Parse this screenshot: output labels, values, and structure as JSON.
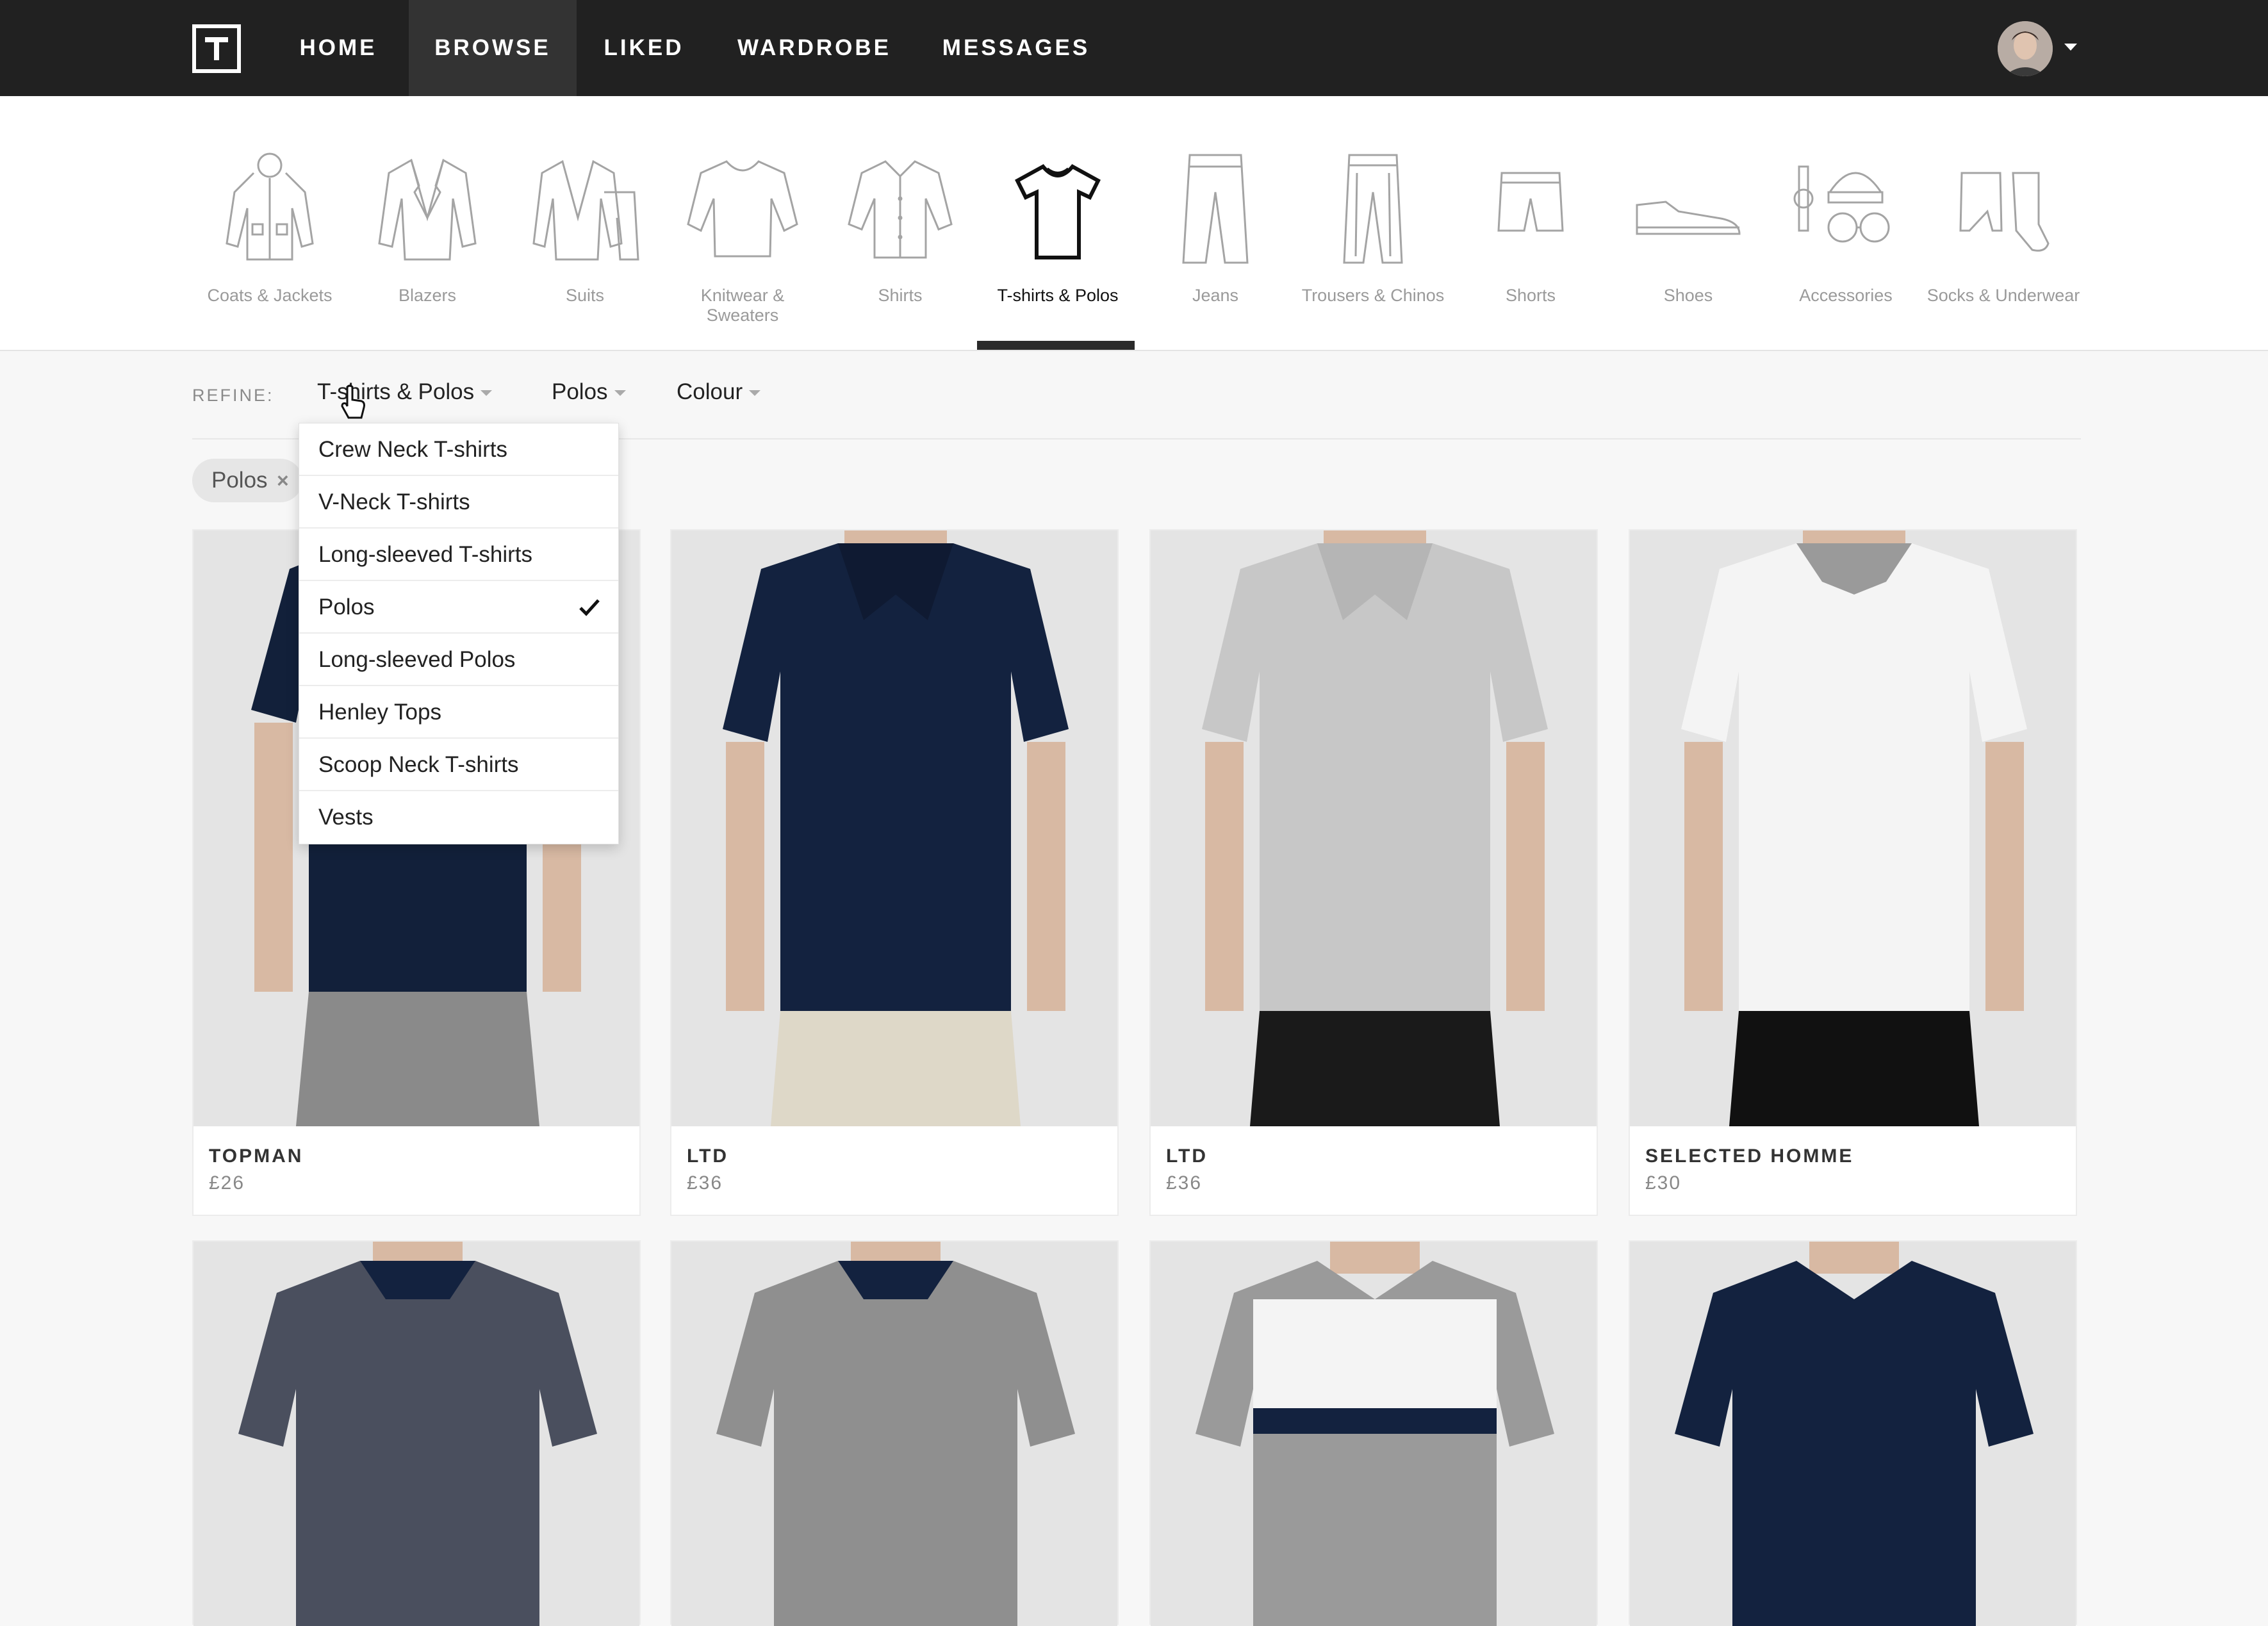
{
  "nav": {
    "items": [
      {
        "label": "HOME"
      },
      {
        "label": "BROWSE",
        "active": true
      },
      {
        "label": "LIKED"
      },
      {
        "label": "WARDROBE"
      },
      {
        "label": "MESSAGES"
      }
    ]
  },
  "categories": [
    {
      "label": "Coats & Jackets",
      "icon": "coat-icon"
    },
    {
      "label": "Blazers",
      "icon": "blazer-icon"
    },
    {
      "label": "Suits",
      "icon": "suit-icon"
    },
    {
      "label": "Knitwear & Sweaters",
      "icon": "sweater-icon"
    },
    {
      "label": "Shirts",
      "icon": "shirt-icon"
    },
    {
      "label": "T-shirts & Polos",
      "icon": "tshirt-icon",
      "active": true
    },
    {
      "label": "Jeans",
      "icon": "jeans-icon"
    },
    {
      "label": "Trousers & Chinos",
      "icon": "trousers-icon"
    },
    {
      "label": "Shorts",
      "icon": "shorts-icon"
    },
    {
      "label": "Shoes",
      "icon": "shoe-icon"
    },
    {
      "label": "Accessories",
      "icon": "accessories-icon"
    },
    {
      "label": "Socks & Underwear",
      "icon": "socks-icon"
    }
  ],
  "refine": {
    "label": "REFINE:",
    "filters": [
      {
        "label": "T-shirts & Polos"
      },
      {
        "label": "Polos"
      },
      {
        "label": "Colour"
      }
    ],
    "chip": "Polos"
  },
  "dropdown": {
    "items": [
      {
        "label": "Crew Neck T-shirts"
      },
      {
        "label": "V-Neck T-shirts"
      },
      {
        "label": "Long-sleeved T-shirts"
      },
      {
        "label": "Polos",
        "selected": true
      },
      {
        "label": "Long-sleeved Polos"
      },
      {
        "label": "Henley Tops"
      },
      {
        "label": "Scoop Neck T-shirts"
      },
      {
        "label": "Vests"
      }
    ]
  },
  "products": [
    {
      "brand": "TOPMAN",
      "price": "£26",
      "shirt_color": "#12203a",
      "bottom_color": "#8a8a8a"
    },
    {
      "brand": "LTD",
      "price": "£36",
      "shirt_color": "#13223f",
      "bottom_color": "#ded8c8"
    },
    {
      "brand": "LTD",
      "price": "£36",
      "shirt_color": "#c7c7c7",
      "bottom_color": "#1a1a1a"
    },
    {
      "brand": "SELECTED HOMME",
      "price": "£30",
      "shirt_color": "#f4f4f4",
      "bottom_color": "#111111"
    },
    {
      "shirt_color": "#4a4f5e"
    },
    {
      "shirt_color": "#8f8f8f"
    },
    {
      "shirt_color": "#9a9a9a"
    },
    {
      "shirt_color": "#13223f"
    }
  ]
}
